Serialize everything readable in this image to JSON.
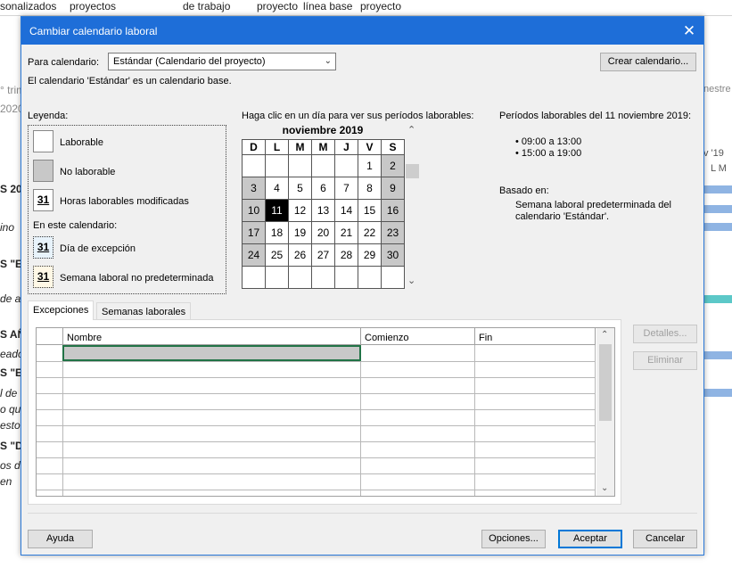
{
  "background": {
    "ribbon": [
      "sonalizados",
      "proyectos",
      "de trabajo",
      "proyecto",
      "línea base",
      "proyecto"
    ],
    "left_rows": [
      "° trim",
      "2020",
      "S 20",
      "ino",
      "S \"E",
      "de a",
      "S AÑ",
      "eado",
      "S \"E",
      "l de",
      "o qu",
      "esto",
      "S \"D",
      "os d",
      "en"
    ],
    "right_rows": [
      "nestre",
      "v '19",
      "L M"
    ]
  },
  "dialog": {
    "title": "Cambiar calendario laboral",
    "close_icon": "close-icon",
    "for_calendar_label": "Para calendario:",
    "for_calendar_value": "Estándar (Calendario del proyecto)",
    "create_calendar_button": "Crear calendario...",
    "base_note": "El calendario 'Estándar' es un calendario base.",
    "legend": {
      "title": "Leyenda:",
      "working": "Laborable",
      "nonworking": "No laborable",
      "modified_hours": "Horas laborables modificadas",
      "modified_hours_sample": "31",
      "in_this_calendar": "En este calendario:",
      "exception_day": "Día de excepción",
      "exception_sample": "31",
      "nondefault_week": "Semana laboral no predeterminada",
      "nondefault_sample": "31"
    },
    "calendar": {
      "instruction": "Haga clic en un día para ver sus períodos laborables:",
      "month": "noviembre 2019",
      "weekdays": [
        "D",
        "L",
        "M",
        "M",
        "J",
        "V",
        "S"
      ],
      "weeks": [
        [
          "",
          "",
          "",
          "",
          "",
          "1",
          "2"
        ],
        [
          "3",
          "4",
          "5",
          "6",
          "7",
          "8",
          "9"
        ],
        [
          "10",
          "11",
          "12",
          "13",
          "14",
          "15",
          "16"
        ],
        [
          "17",
          "18",
          "19",
          "20",
          "21",
          "22",
          "23"
        ],
        [
          "24",
          "25",
          "26",
          "27",
          "28",
          "29",
          "30"
        ],
        [
          "",
          "",
          "",
          "",
          "",
          "",
          ""
        ]
      ],
      "selected_day": "11"
    },
    "periods": {
      "title": "Períodos laborables del 11 noviembre 2019:",
      "items": [
        "• 09:00 a 13:00",
        "• 15:00 a 19:00"
      ],
      "based_on_label": "Basado en:",
      "based_on_line1": "Semana laboral predeterminada del",
      "based_on_line2": "calendario 'Estándar'."
    },
    "tabs": [
      "Excepciones",
      "Semanas laborales"
    ],
    "grid_headers": [
      "Nombre",
      "Comienzo",
      "Fin"
    ],
    "details_button": "Detalles...",
    "delete_button": "Eliminar",
    "help_button": "Ayuda",
    "options_button": "Opciones...",
    "accept_button": "Aceptar",
    "cancel_button": "Cancelar"
  }
}
